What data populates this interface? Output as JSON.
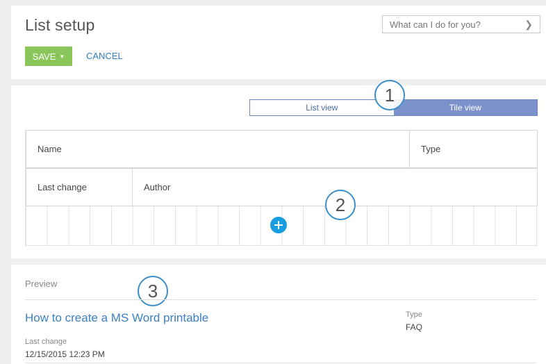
{
  "header": {
    "title": "List setup",
    "search_placeholder": "What can I do for you?",
    "save_label": "SAVE",
    "cancel_label": "CANCEL"
  },
  "view_toggle": {
    "options": [
      "List view",
      "Tile view"
    ],
    "selected": "Tile view"
  },
  "tile_grid": {
    "row1": [
      "Name",
      "Type"
    ],
    "row2": [
      "Last change",
      "Author"
    ]
  },
  "callouts": [
    "1",
    "2",
    "3"
  ],
  "preview": {
    "label": "Preview",
    "article_title": "How to create a MS Word printable",
    "type_label": "Type",
    "type_value": "FAQ",
    "last_change_label": "Last change",
    "last_change_value": "12/15/2015 12:23 PM"
  },
  "colors": {
    "save_green": "#8ac65a",
    "link_blue": "#3c7fc2",
    "toggle_selected": "#7a91c9",
    "add_button_blue": "#1a9ce0",
    "callout_ring": "#3c8ec8"
  },
  "icons": {
    "search_chevron": "chevron-right-icon",
    "save_caret": "caret-down-icon",
    "add": "plus-icon"
  }
}
